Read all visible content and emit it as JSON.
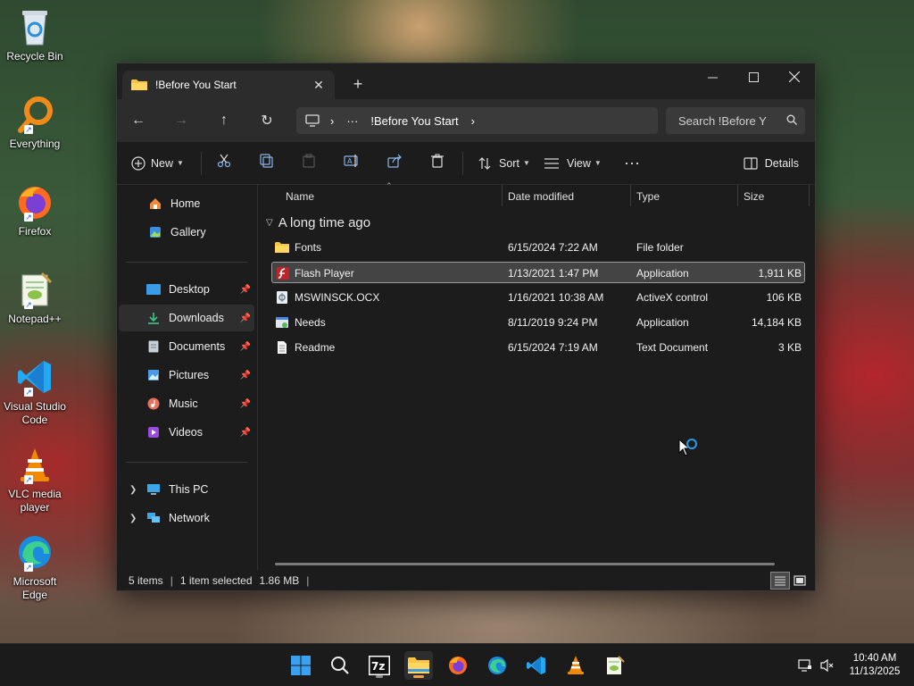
{
  "desktop": {
    "icons": [
      {
        "label": "Recycle Bin",
        "icon": "recycle-bin-icon"
      },
      {
        "label": "Everything",
        "icon": "everything-search-icon"
      },
      {
        "label": "Firefox",
        "icon": "firefox-icon"
      },
      {
        "label": "Notepad++",
        "icon": "notepad-plus-plus-icon"
      },
      {
        "label": "Visual Studio Code",
        "icon": "vscode-icon"
      },
      {
        "label": "VLC media player",
        "icon": "vlc-icon"
      },
      {
        "label": "Microsoft Edge",
        "icon": "edge-icon"
      }
    ]
  },
  "window": {
    "tab_title": "!Before You Start",
    "tab_close": "✕",
    "new_tab": "+",
    "controls": {
      "minimize": "—",
      "maximize": "☐",
      "close": "✕"
    },
    "nav": {
      "back": "←",
      "forward": "→",
      "up": "↑",
      "refresh": "↻"
    },
    "address": {
      "overflow": "···",
      "crumb": "!Before You Start",
      "chevron": "›"
    },
    "search": {
      "placeholder": "Search !Before Y"
    },
    "toolbar": {
      "new_label": "New",
      "sort_label": "Sort",
      "view_label": "View",
      "more_label": "···",
      "details_label": "Details"
    },
    "sidebar": {
      "items": [
        {
          "label": "Home",
          "icon": "home-icon"
        },
        {
          "label": "Gallery",
          "icon": "gallery-icon"
        },
        {
          "label": "Desktop",
          "icon": "desktop-folder-icon",
          "pinned": true
        },
        {
          "label": "Downloads",
          "icon": "downloads-icon",
          "pinned": true,
          "selected": true
        },
        {
          "label": "Documents",
          "icon": "documents-icon",
          "pinned": true
        },
        {
          "label": "Pictures",
          "icon": "pictures-icon",
          "pinned": true
        },
        {
          "label": "Music",
          "icon": "music-icon",
          "pinned": true
        },
        {
          "label": "Videos",
          "icon": "videos-icon",
          "pinned": true
        },
        {
          "label": "This PC",
          "icon": "this-pc-icon"
        },
        {
          "label": "Network",
          "icon": "network-icon"
        }
      ]
    },
    "columns": {
      "name": "Name",
      "date": "Date modified",
      "type": "Type",
      "size": "Size"
    },
    "group": {
      "label": "A long time ago"
    },
    "files": [
      {
        "name": "Fonts",
        "date": "6/15/2024 7:22 AM",
        "type": "File folder",
        "size": "",
        "icon": "folder-icon",
        "selected": false
      },
      {
        "name": "Flash Player",
        "date": "1/13/2021 1:47 PM",
        "type": "Application",
        "size": "1,911 KB",
        "icon": "flash-player-icon",
        "selected": true
      },
      {
        "name": "MSWINSCK.OCX",
        "date": "1/16/2021 10:38 AM",
        "type": "ActiveX control",
        "size": "106 KB",
        "icon": "ocx-file-icon",
        "selected": false
      },
      {
        "name": "Needs",
        "date": "8/11/2019 9:24 PM",
        "type": "Application",
        "size": "14,184 KB",
        "icon": "application-icon",
        "selected": false
      },
      {
        "name": "Readme",
        "date": "6/15/2024 7:19 AM",
        "type": "Text Document",
        "size": "3 KB",
        "icon": "text-document-icon",
        "selected": false
      }
    ],
    "status": {
      "count": "5 items",
      "selection": "1 item selected",
      "size": "1.86 MB",
      "sep": "|"
    }
  },
  "taskbar": {
    "apps": [
      "start-icon",
      "search-icon",
      "7zip-icon",
      "file-explorer-icon",
      "firefox-icon",
      "edge-icon",
      "vscode-icon",
      "vlc-icon",
      "notepad-plus-plus-icon"
    ],
    "time": "10:40 AM",
    "date": "11/13/2025"
  }
}
